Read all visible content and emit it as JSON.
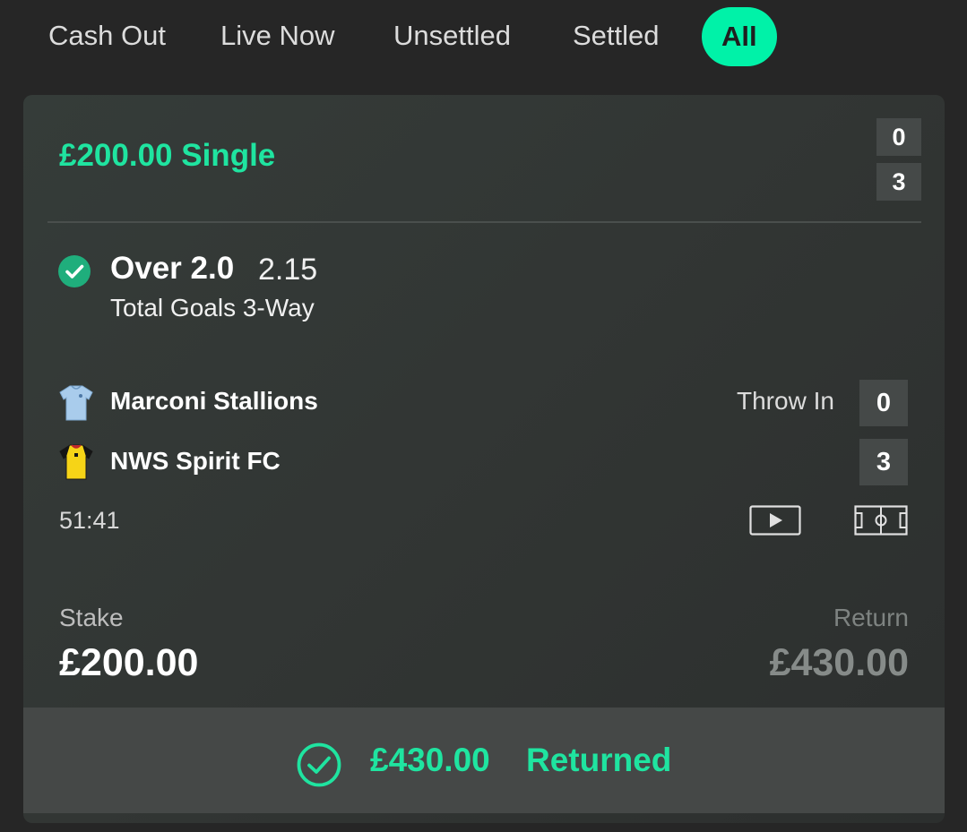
{
  "tabs": [
    {
      "label": "Cash Out"
    },
    {
      "label": "Live Now"
    },
    {
      "label": "Unsettled"
    },
    {
      "label": "Settled"
    },
    {
      "label": "All"
    }
  ],
  "active_tab": "All",
  "bet": {
    "title": "£200.00 Single",
    "mini_scores": [
      "0",
      "3"
    ],
    "selection": {
      "name": "Over 2.0",
      "odds": "2.15",
      "market": "Total Goals 3-Way",
      "status_icon": "check-circle-icon"
    },
    "event": {
      "home": {
        "name": "Marconi Stallions",
        "score": "0",
        "kit_icon": "light-blue-shirt-icon"
      },
      "away": {
        "name": "NWS Spirit FC",
        "score": "3",
        "kit_icon": "yellow-black-shirt-icon"
      },
      "live_status": "Throw In",
      "clock": "51:41",
      "actions": [
        "play-video-icon",
        "pitch-view-icon"
      ]
    },
    "stake_label": "Stake",
    "stake_value": "£200.00",
    "return_label": "Return",
    "return_value": "£430.00",
    "footer": {
      "amount": "£430.00",
      "status": "Returned"
    }
  },
  "colors": {
    "accent": "#1fe4a0",
    "tab_active_bg": "#00f2a8",
    "background": "#262626",
    "card": "#333836",
    "score_box": "#454948"
  }
}
